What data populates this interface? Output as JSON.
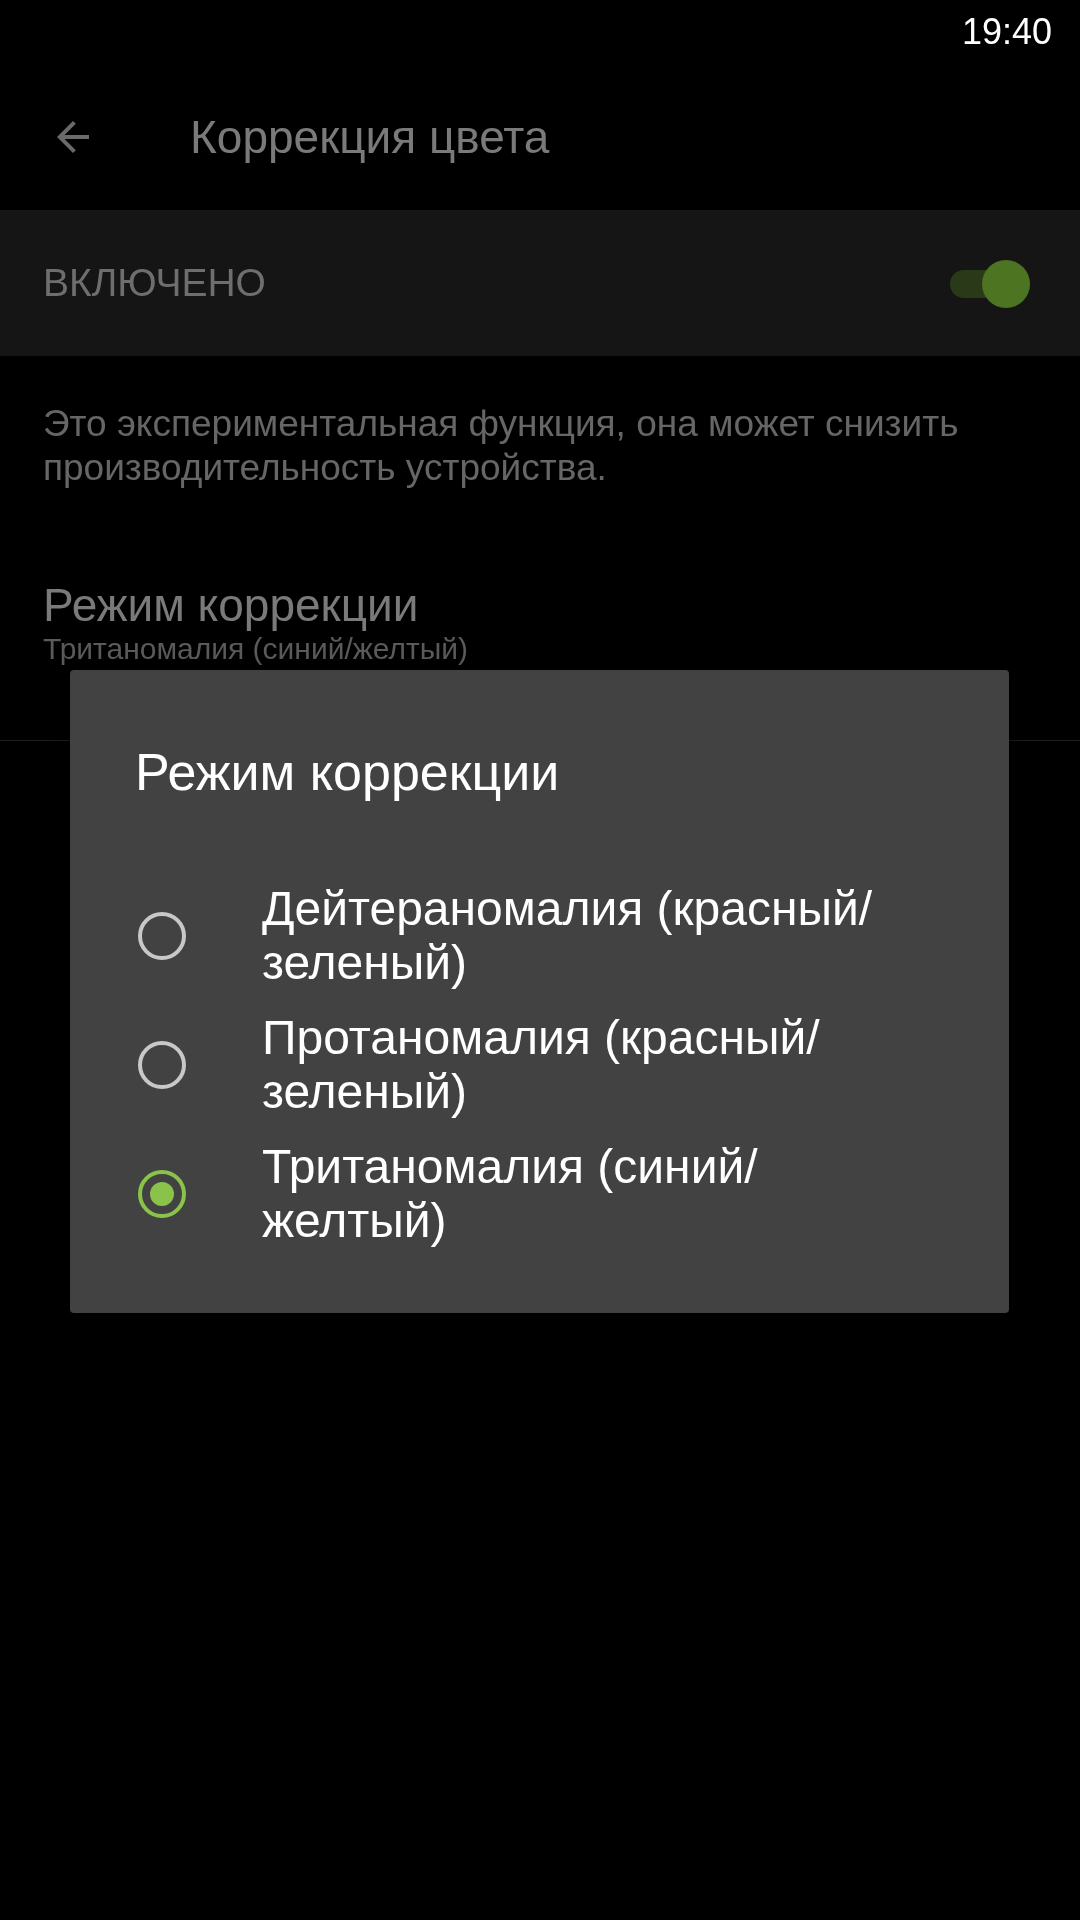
{
  "status_bar": {
    "time": "19:40"
  },
  "toolbar": {
    "title": "Коррекция цвета"
  },
  "master_switch": {
    "label": "ВКЛЮЧЕНО",
    "on": true
  },
  "description": "Это экспериментальная функция, она может снизить производительность устройства.",
  "setting": {
    "title": "Режим коррекции",
    "summary": "Тританомалия (синий/желтый)"
  },
  "dialog": {
    "title": "Режим коррекции",
    "options": [
      {
        "label": "Дейтераномалия (красный/зеленый)",
        "selected": false
      },
      {
        "label": "Протаномалия (красный/зеленый)",
        "selected": false
      },
      {
        "label": "Тританомалия (синий/желтый)",
        "selected": true
      }
    ]
  }
}
